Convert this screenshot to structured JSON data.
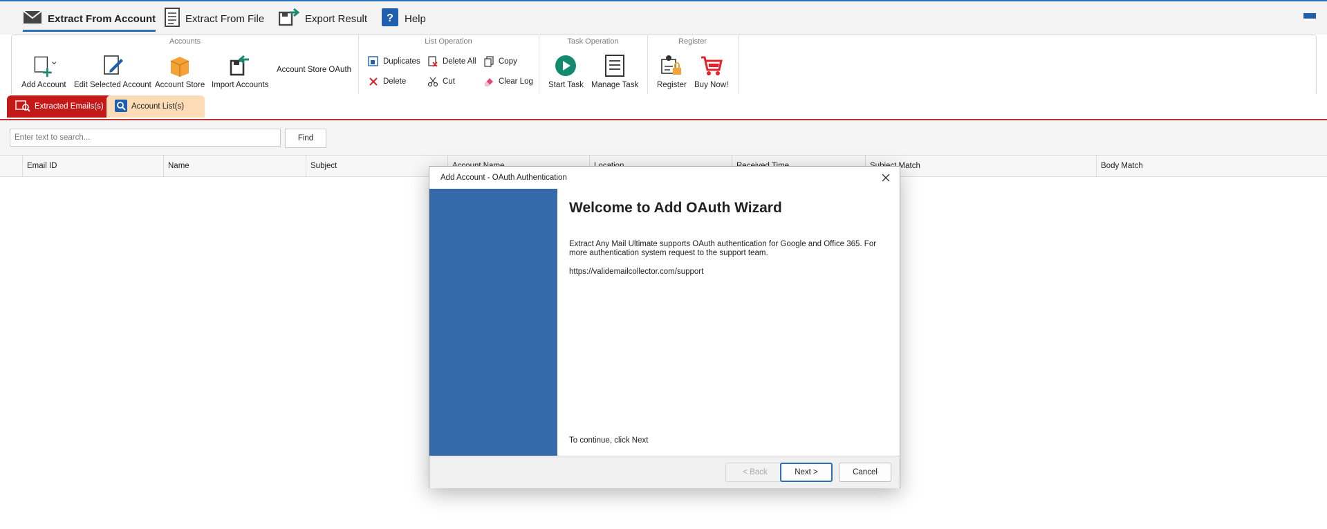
{
  "top_tabs": [
    {
      "label": "Extract From Account",
      "icon": "envelope-icon"
    },
    {
      "label": "Extract From File",
      "icon": "document-icon"
    },
    {
      "label": "Export Result",
      "icon": "export-icon"
    },
    {
      "label": "Help",
      "icon": "help-icon"
    }
  ],
  "ribbon": {
    "accounts": {
      "title": "Accounts",
      "add_account": "Add Account",
      "edit_selected_account": "Edit Selected Account",
      "account_store": "Account Store",
      "import_accounts": "Import Accounts",
      "account_store_oauth": "Account Store OAuth"
    },
    "list_operation": {
      "title": "List Operation",
      "duplicates": "Duplicates",
      "delete_all": "Delete All",
      "copy": "Copy",
      "delete": "Delete",
      "cut": "Cut",
      "clear_log": "Clear Log"
    },
    "task_operation": {
      "title": "Task Operation",
      "start_task": "Start Task",
      "manage_task": "Manage Task"
    },
    "register": {
      "title": "Register",
      "register": "Register",
      "buy_now": "Buy Now!"
    }
  },
  "doc_tabs": {
    "extracted": "Extracted Emails(s)",
    "account_list": "Account List(s)"
  },
  "search": {
    "placeholder": "Enter text to search...",
    "find_label": "Find"
  },
  "grid": {
    "columns": [
      "Email ID",
      "Name",
      "Subject",
      "Account Name",
      "Location",
      "Received Time",
      "Subject Match",
      "Body Match"
    ]
  },
  "dialog": {
    "title": "Add Account - OAuth Authentication",
    "heading": "Welcome to Add OAuth Wizard",
    "description": "Extract Any Mail Ultimate supports OAuth authentication for Google and Office 365. For more authentication system request to the support team.",
    "url": "https://validemailcollector.com/support",
    "continue_text": "To continue, click Next",
    "back_label": "< Back",
    "next_label": "Next >",
    "cancel_label": "Cancel"
  },
  "colors": {
    "accent": "#2f6fb6",
    "wizard_side": "#3469aa",
    "active_tab": "#c41919",
    "inactive_tab": "#fbdcb6"
  }
}
